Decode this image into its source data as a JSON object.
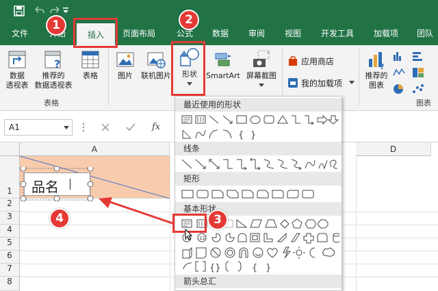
{
  "quick_access": {
    "save_icon": "save-icon",
    "undo_icon": "undo-icon",
    "redo_icon": "redo-icon"
  },
  "tabs": [
    {
      "label": "文件"
    },
    {
      "label": "开始"
    },
    {
      "label": "插入",
      "active": true
    },
    {
      "label": "页面布局"
    },
    {
      "label": "公式"
    },
    {
      "label": "数据"
    },
    {
      "label": "审阅"
    },
    {
      "label": "视图"
    },
    {
      "label": "开发工具"
    },
    {
      "label": "加载项"
    },
    {
      "label": "团队"
    }
  ],
  "ribbon": {
    "pivot_table": {
      "line1": "数据",
      "line2": "透视表"
    },
    "recommended_pivot": {
      "line1": "推荐的",
      "line2": "数据透视表"
    },
    "table": {
      "label": "表格"
    },
    "group_tables": "表格",
    "pictures": {
      "label": "图片"
    },
    "online_pictures": {
      "label": "联机图片"
    },
    "shapes": {
      "label": "形状"
    },
    "smartart": {
      "label": "SmartArt"
    },
    "screenshot": {
      "label": "屏幕截图"
    },
    "app_store": {
      "label": "应用商店"
    },
    "my_addins": {
      "label": "我的加载项"
    },
    "recommended_charts": {
      "line1": "推荐的",
      "line2": "图表"
    },
    "group_charts": "图表"
  },
  "formula_bar": {
    "name_box": "A1",
    "fx": "fx",
    "cancel_icon": "cancel-icon",
    "enter_icon": "check-icon"
  },
  "grid": {
    "columns": [
      "A",
      "D"
    ],
    "rows": [
      "1",
      "2",
      "3",
      "4",
      "5",
      "6",
      "7",
      "8"
    ],
    "textbox_text": "品名"
  },
  "shapes_menu": {
    "recent": "最近使用的形状",
    "lines": "线条",
    "rectangles": "矩形",
    "basic": "基本形状",
    "arrows": "箭头总汇"
  },
  "annotations": {
    "b1": "1",
    "b2": "2",
    "b3": "3",
    "b4": "4"
  },
  "colors": {
    "excel_green": "#217346",
    "highlight_red": "#e53935",
    "cell_fill": "#f8cbad"
  }
}
